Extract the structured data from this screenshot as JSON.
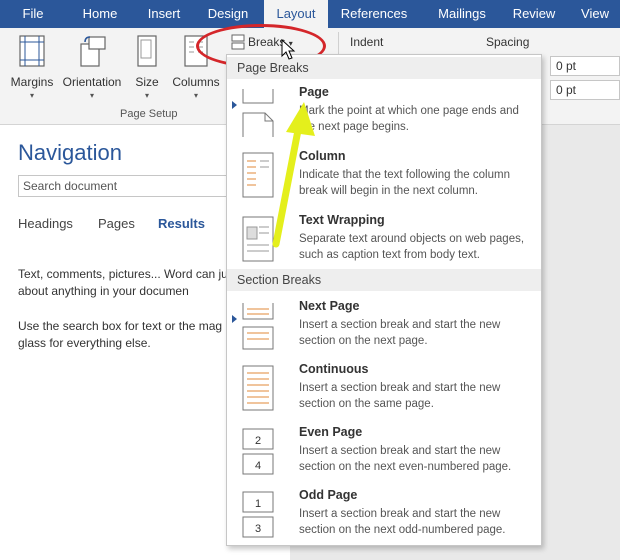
{
  "tabs": [
    "File",
    "Home",
    "Insert",
    "Design",
    "Layout",
    "References",
    "Mailings",
    "Review",
    "View"
  ],
  "ribbon": {
    "margins": "Margins",
    "orientation": "Orientation",
    "size": "Size",
    "columns": "Columns",
    "page_setup": "Page Setup",
    "breaks": "Breaks",
    "indent": "Indent",
    "spacing": "Spacing",
    "spacing_before": "0 pt",
    "spacing_after": "0 pt"
  },
  "nav": {
    "title": "Navigation",
    "search_value": "Search document",
    "tabs": [
      "Headings",
      "Pages",
      "Results"
    ],
    "msg1": "Text, comments, pictures... Word can just about anything in your documen",
    "msg2": "Use the search box for text or the mag glass for everything else."
  },
  "menu": {
    "page_breaks_header": "Page Breaks",
    "section_breaks_header": "Section Breaks",
    "items": [
      {
        "title": "Page",
        "desc": "Mark the point at which one page ends and the next page begins."
      },
      {
        "title": "Column",
        "desc": "Indicate that the text following the column break will begin in the next column."
      },
      {
        "title": "Text Wrapping",
        "desc": "Separate text around objects on web pages, such as caption text from body text."
      },
      {
        "title": "Next Page",
        "desc": "Insert a section break and start the new section on the next page."
      },
      {
        "title": "Continuous",
        "desc": "Insert a section break and start the new section on the same page."
      },
      {
        "title": "Even Page",
        "desc": "Insert a section break and start the new section on the next even-numbered page."
      },
      {
        "title": "Odd Page",
        "desc": "Insert a section break and start the new section on the next odd-numbered page."
      }
    ],
    "even_icon_nums": [
      "2",
      "4"
    ],
    "odd_icon_nums": [
      "1",
      "3"
    ]
  },
  "colors": {
    "ribbon_blue": "#2b579a",
    "highlight_red": "#d4262a",
    "arrow_yellow": "#e4ef1c"
  }
}
